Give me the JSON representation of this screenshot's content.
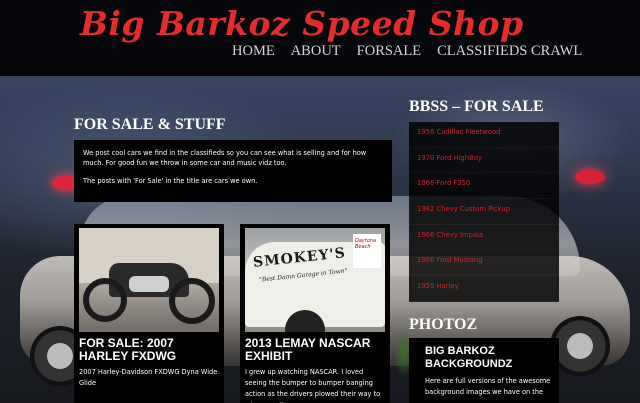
{
  "site": {
    "title": "Big Barkoz Speed Shop"
  },
  "nav": {
    "items": [
      "HOME",
      "ABOUT",
      "FORSALE",
      "CLASSIFIEDS CRAWL"
    ]
  },
  "main": {
    "heading": "FOR SALE & STUFF",
    "intro": [
      "We post cool cars we find in the classifieds so you can see what is selling and for how much. For good fun we throw in some car and music vidz too.",
      "The posts with 'For Sale' in the title are cars we own."
    ],
    "posts": [
      {
        "title": "FOR SALE: 2007 HARLEY FXDWG",
        "excerpt": "2007 Harley-Davidson FXDWG Dyna Wide Glide"
      },
      {
        "title": "2013 LEMAY NASCAR EXHIBIT",
        "excerpt": "I grew up watching NASCAR.  I loved seeing the bumper to bumper banging action as the drivers plowed their way to win no matter"
      }
    ],
    "nascar_image": {
      "sign": "SMOKEY'S",
      "sub": "\"Best Damn Garage in Town\"",
      "badge": "Daytona Beach"
    }
  },
  "sidebar": {
    "bbss_heading": "BBSS – FOR SALE",
    "items": [
      "1956 Cadillac Fleetwood",
      "1970 Ford HighBoy",
      "1966 Ford F350",
      "1982 Chevy Custom Pickup",
      "1966 Chevy Impala",
      "1966 Ford Mustang",
      "1959 Harley"
    ],
    "photoz_heading": "PHOTOZ",
    "photoz_title": "BIG BARKOZ BACKGROUNDZ",
    "photoz_text": "Here are full versions of the awesome background images we have on the"
  },
  "colors": {
    "brand_red": "#e42c2c",
    "link_red": "#c6262c",
    "header_bg": "#05060a"
  }
}
